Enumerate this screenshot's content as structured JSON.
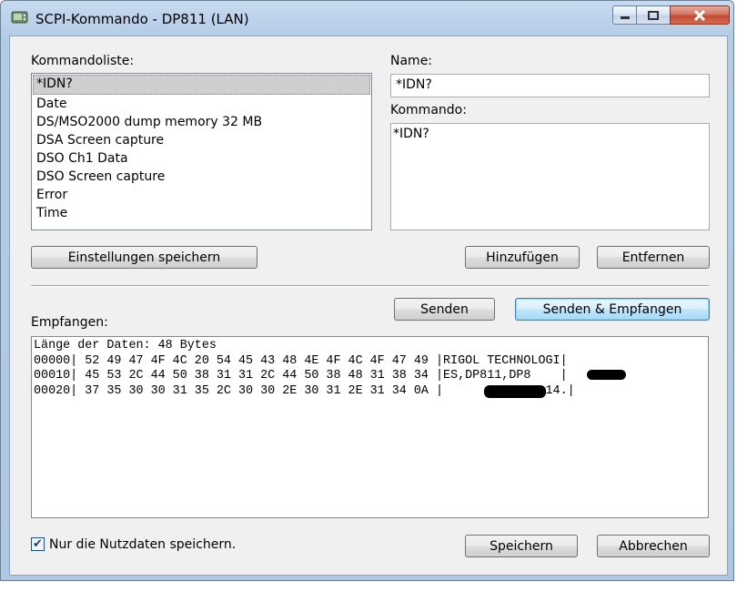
{
  "window": {
    "title": "SCPI-Kommando - DP811 (LAN)"
  },
  "commands": {
    "label": "Kommandoliste:",
    "items": [
      "*IDN?",
      "Date",
      "DS/MSO2000 dump memory 32 MB",
      "DSA Screen capture",
      "DSO Ch1 Data",
      "DSO Screen capture",
      "Error",
      "Time"
    ],
    "selected_index": 0
  },
  "name": {
    "label": "Name:",
    "value": "*IDN?"
  },
  "command": {
    "label": "Kommando:",
    "value": "*IDN?"
  },
  "buttons": {
    "save_settings": "Einstellungen speichern",
    "add": "Hinzufügen",
    "remove": "Entfernen",
    "send": "Senden",
    "send_receive": "Senden & Empfangen",
    "save": "Speichern",
    "cancel": "Abbrechen"
  },
  "receive": {
    "label": "Empfangen:",
    "lines": [
      "Länge der Daten: 48 Bytes",
      "00000| 52 49 47 4F 4C 20 54 45 43 48 4E 4F 4C 4F 47 49 |RIGOL TECHNOLOGI|",
      "00010| 45 53 2C 44 50 38 31 31 2C 44 50 38 48 31 38 34 |ES,DP811,DP8    |",
      "00020| 37 35 30 30 31 35 2C 30 30 2E 30 31 2E 31 34 0A |       ,00.01.14.|"
    ]
  },
  "payload_only": {
    "label": "Nur die Nutzdaten speichern.",
    "checked": true
  }
}
